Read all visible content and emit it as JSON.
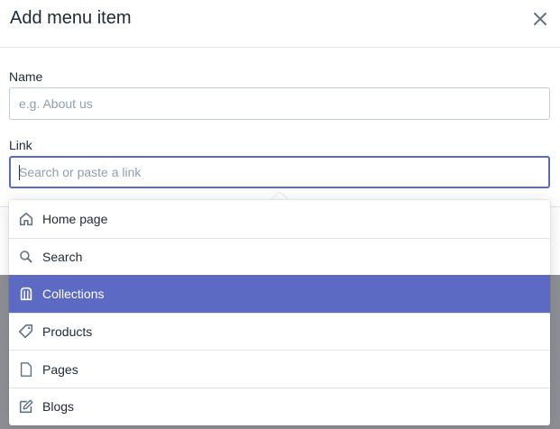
{
  "modal": {
    "title": "Add menu item",
    "close_icon": "close-icon"
  },
  "form": {
    "name": {
      "label": "Name",
      "placeholder": "e.g. About us",
      "value": ""
    },
    "link": {
      "label": "Link",
      "placeholder": "Search or paste a link",
      "value": ""
    }
  },
  "dropdown": {
    "items": [
      {
        "label": "Home page",
        "icon": "home-icon",
        "active": false
      },
      {
        "label": "Search",
        "icon": "search-icon",
        "active": false
      },
      {
        "label": "Collections",
        "icon": "collections-icon",
        "active": true
      },
      {
        "label": "Products",
        "icon": "tag-icon",
        "active": false
      },
      {
        "label": "Pages",
        "icon": "page-icon",
        "active": false
      },
      {
        "label": "Blogs",
        "icon": "blog-icon",
        "active": false
      }
    ]
  },
  "colors": {
    "accent": "#5c6ac4",
    "text": "#212b36",
    "icon": "#637381",
    "placeholder": "#919eab"
  }
}
